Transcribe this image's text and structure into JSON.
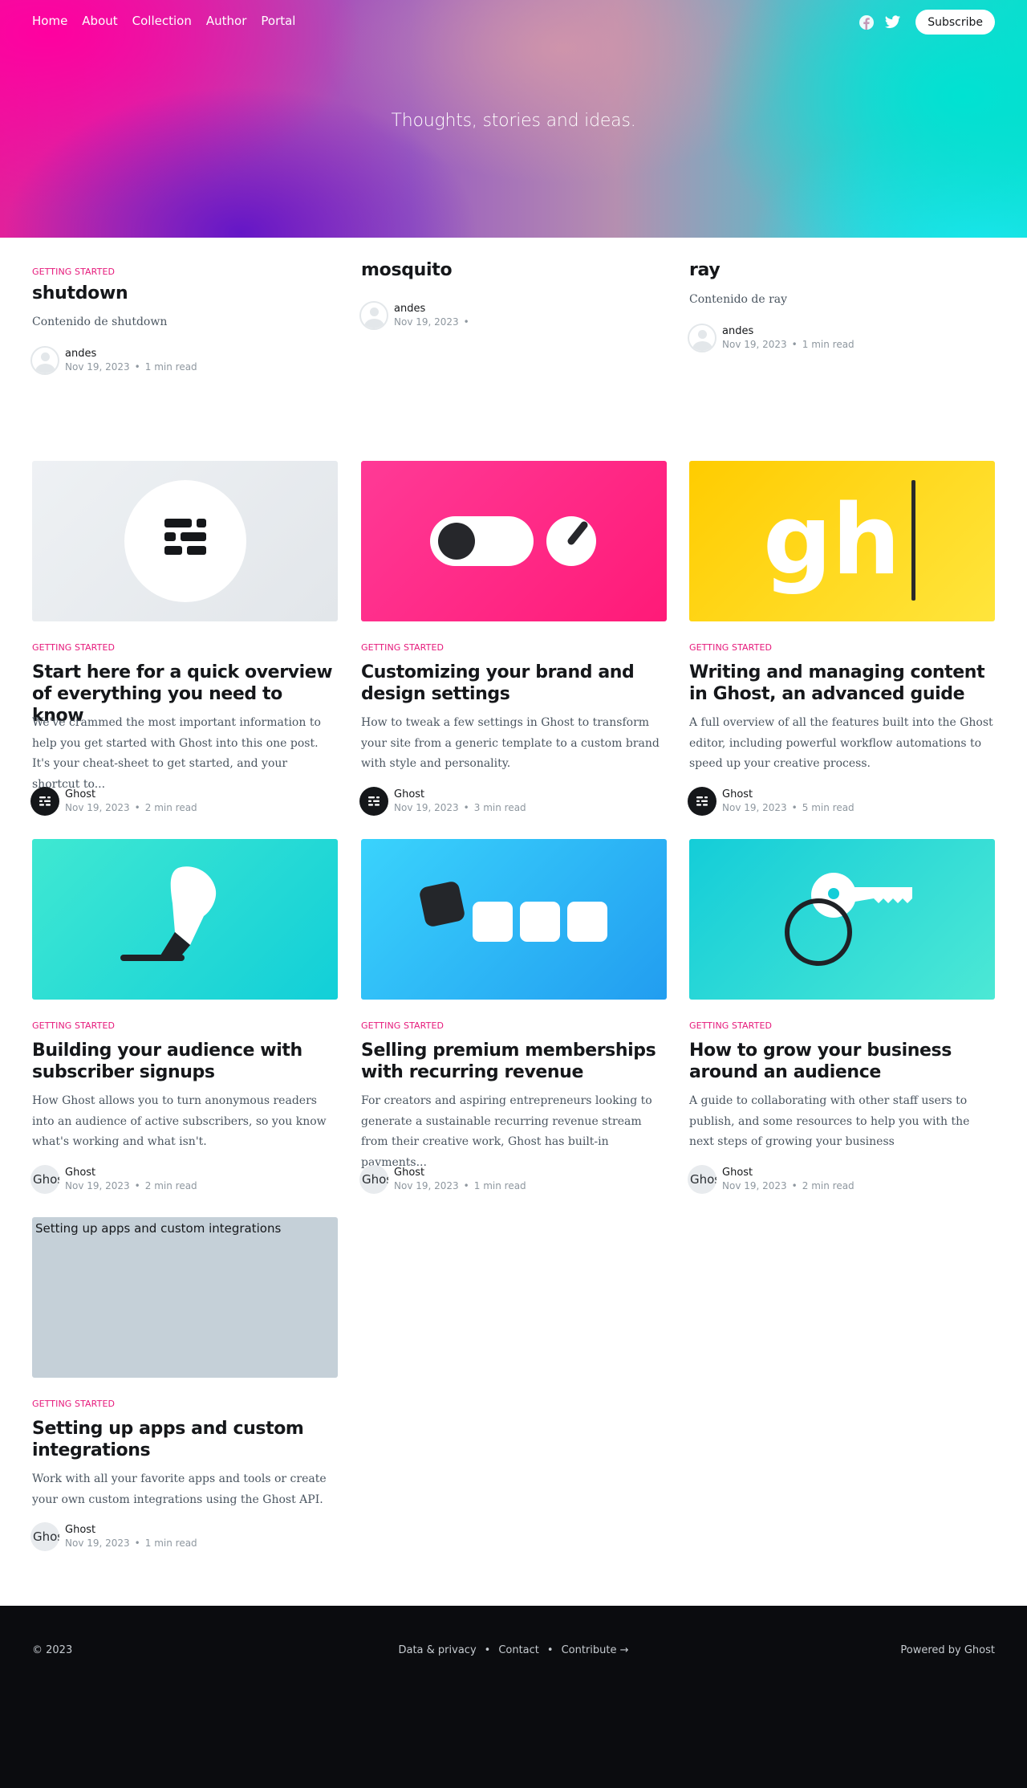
{
  "nav": {
    "items": [
      "Home",
      "About",
      "Collection",
      "Author",
      "Portal"
    ],
    "social": [
      "facebook-icon",
      "twitter-icon"
    ],
    "subscribe_label": "Subscribe"
  },
  "hero": {
    "description": "Thoughts, stories and ideas."
  },
  "featured": [
    {
      "tag": "Getting Started",
      "title": "shutdown",
      "excerpt": "Contenido de shutdown",
      "author": "andes",
      "date": "Nov 19, 2023",
      "read": "1 min read"
    },
    {
      "tag": "",
      "title": "mosquito",
      "excerpt": "",
      "author": "andes",
      "date": "Nov 19, 2023",
      "read": ""
    },
    {
      "tag": "",
      "title": "ray",
      "excerpt": "Contenido de ray",
      "author": "andes",
      "date": "Nov 19, 2023",
      "read": "1 min read"
    }
  ],
  "posts": [
    {
      "tag": "Getting Started",
      "title": "Start here for a quick overview of everything you need to know",
      "excerpt": "We've crammed the most important information to help you get started with Ghost into this one post. It's your cheat-sheet to get started, and your shortcut to...",
      "author": "Ghost",
      "date": "Nov 19, 2023",
      "read": "2 min read"
    },
    {
      "tag": "Getting Started",
      "title": "Customizing your brand and design settings",
      "excerpt": "How to tweak a few settings in Ghost to transform your site from a generic template to a custom brand with style and personality.",
      "author": "Ghost",
      "date": "Nov 19, 2023",
      "read": "3 min read"
    },
    {
      "tag": "Getting Started",
      "title": "Writing and managing content in Ghost, an advanced guide",
      "excerpt": "A full overview of all the features built into the Ghost editor, including powerful workflow automations to speed up your creative process.",
      "author": "Ghost",
      "date": "Nov 19, 2023",
      "read": "5 min read"
    },
    {
      "tag": "Getting Started",
      "title": "Building your audience with subscriber signups",
      "excerpt": "How Ghost allows you to turn anonymous readers into an audience of active subscribers, so you know what's working and what isn't.",
      "author": "Ghost",
      "date": "Nov 19, 2023",
      "read": "2 min read",
      "avatar_text": "Ghost"
    },
    {
      "tag": "Getting Started",
      "title": "Selling premium memberships with recurring revenue",
      "excerpt": "For creators and aspiring entrepreneurs looking to generate a sustainable recurring revenue stream from their creative work, Ghost has built-in payments...",
      "author": "Ghost",
      "date": "Nov 19, 2023",
      "read": "1 min read",
      "avatar_text": "Ghost"
    },
    {
      "tag": "Getting Started",
      "title": "How to grow your business around an audience",
      "excerpt": "A guide to collaborating with other staff users to publish, and some resources to help you with the next steps of growing your business",
      "author": "Ghost",
      "date": "Nov 19, 2023",
      "read": "2 min read",
      "avatar_text": "Ghost"
    },
    {
      "tag": "Getting Started",
      "title": "Setting up apps and custom integrations",
      "excerpt": "Work with all your favorite apps and tools or create your own custom integrations using the Ghost API.",
      "author": "Ghost",
      "date": "Nov 19, 2023",
      "read": "1 min read",
      "avatar_text": "Ghost",
      "image_alt": "Setting up apps and custom integrations"
    }
  ],
  "thumb_glyph": "gh",
  "footer": {
    "copyright": "© 2023",
    "links": [
      "Data & privacy",
      "Contact",
      "Contribute →"
    ],
    "powered": "Powered by Ghost"
  },
  "colors": {
    "accent": "#e6197b",
    "footer_bg": "#0b0c0f"
  }
}
